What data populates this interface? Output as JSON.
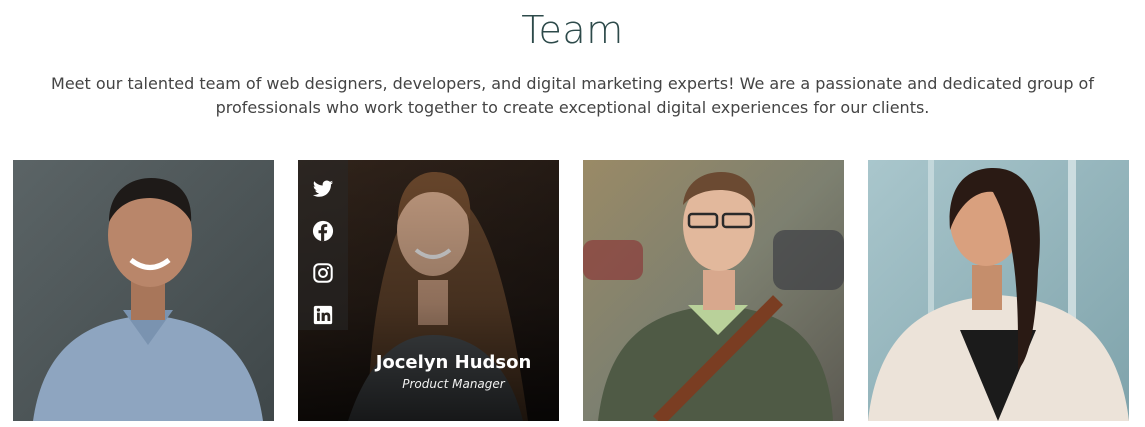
{
  "section": {
    "title": "Team",
    "intro": "Meet our talented team of web designers, developers, and digital marketing experts! We are a passionate and dedicated group of professionals who work together to create exceptional digital experiences for our clients."
  },
  "members": [
    {
      "photo": "team-member-photo-1"
    },
    {
      "photo": "team-member-photo-2",
      "name": "Jocelyn Hudson",
      "role": "Product Manager",
      "social": [
        "twitter-icon",
        "facebook-icon",
        "instagram-icon",
        "linkedin-icon"
      ]
    },
    {
      "photo": "team-member-photo-3"
    },
    {
      "photo": "team-member-photo-4"
    }
  ],
  "colors": {
    "title": "#2d4a4a",
    "text": "#444444",
    "overlay_text": "#ffffff"
  }
}
